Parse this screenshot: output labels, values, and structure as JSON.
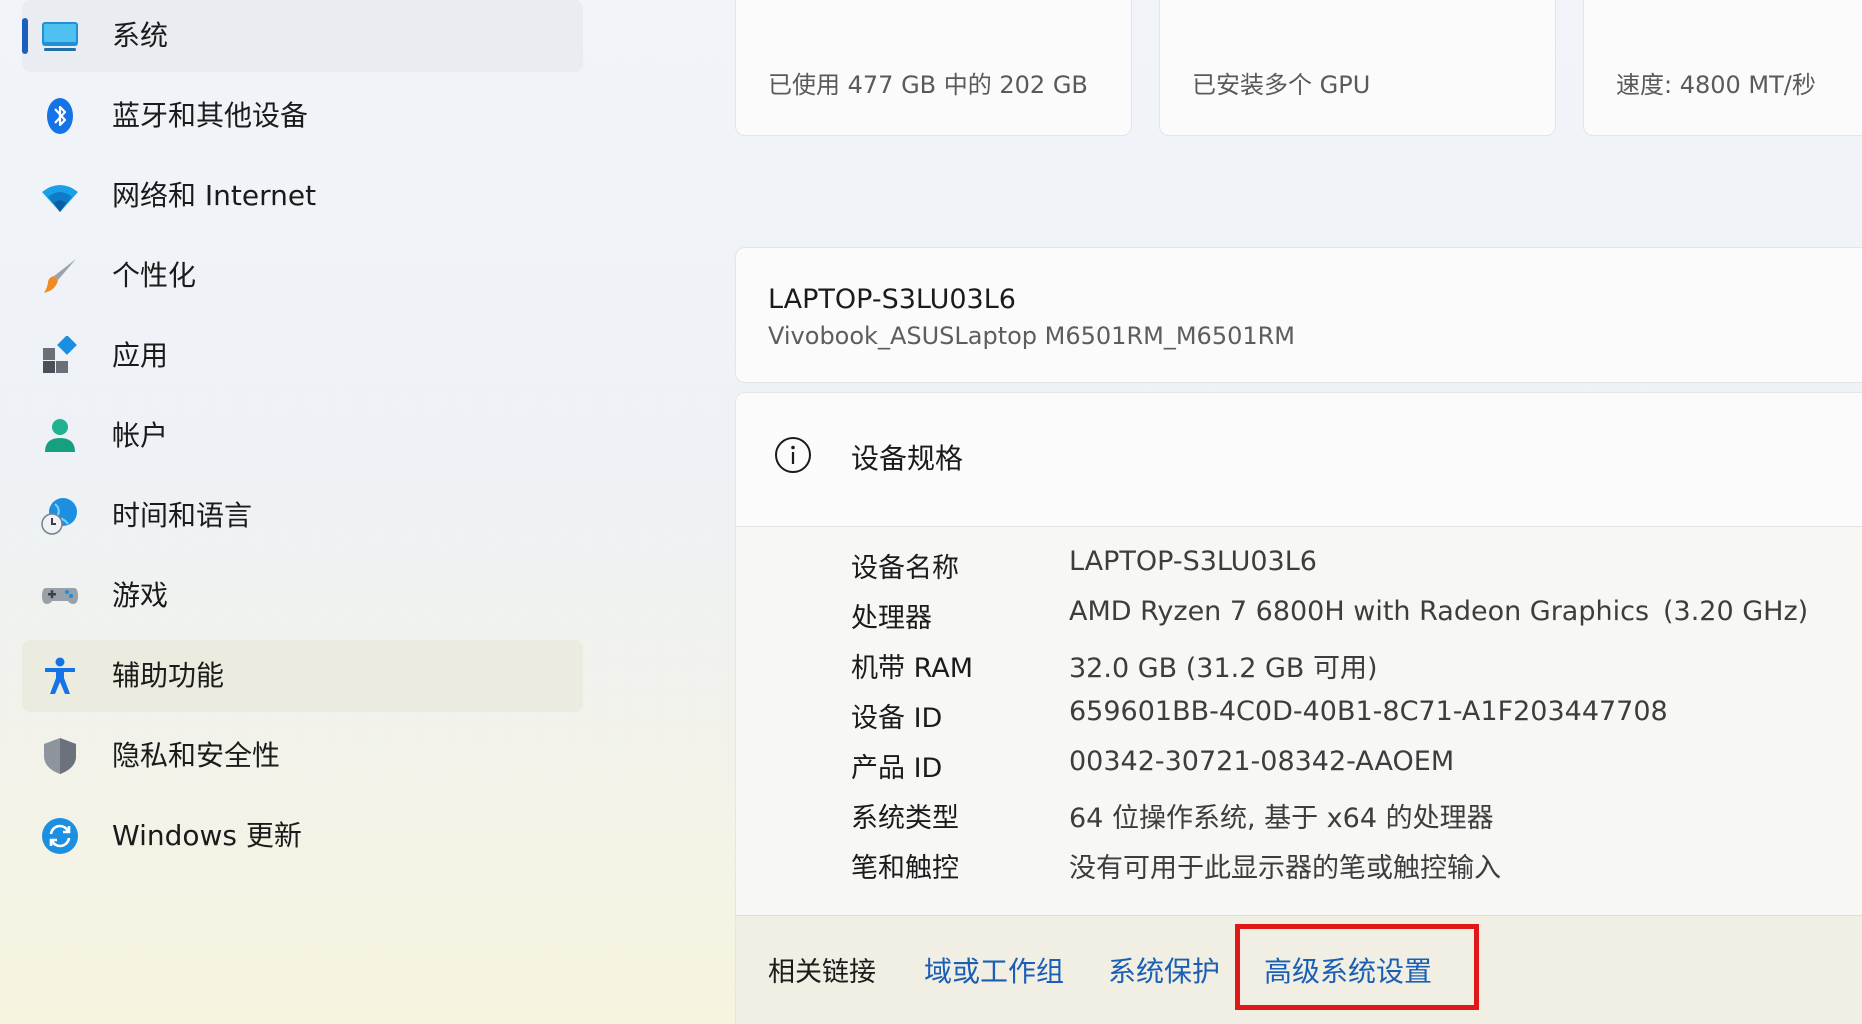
{
  "sidebar": {
    "items": [
      {
        "label": "系统",
        "icon": "monitor-icon"
      },
      {
        "label": "蓝牙和其他设备",
        "icon": "bluetooth-icon"
      },
      {
        "label": "网络和 Internet",
        "icon": "wifi-icon"
      },
      {
        "label": "个性化",
        "icon": "brush-icon"
      },
      {
        "label": "应用",
        "icon": "apps-icon"
      },
      {
        "label": "帐户",
        "icon": "person-icon"
      },
      {
        "label": "时间和语言",
        "icon": "globe-clock-icon"
      },
      {
        "label": "游戏",
        "icon": "gamepad-icon"
      },
      {
        "label": "辅助功能",
        "icon": "accessibility-icon"
      },
      {
        "label": "隐私和安全性",
        "icon": "shield-icon"
      },
      {
        "label": "Windows 更新",
        "icon": "sync-icon"
      }
    ]
  },
  "top_cards": [
    {
      "text": "已使用 477 GB 中的 202 GB"
    },
    {
      "text": "已安装多个 GPU"
    },
    {
      "text": "速度: 4800 MT/秒"
    }
  ],
  "device": {
    "name": "LAPTOP-S3LU03L6",
    "model": "Vivobook_ASUSLaptop M6501RM_M6501RM"
  },
  "specs": {
    "title": "设备规格",
    "rows": [
      {
        "key": "设备名称",
        "value": "LAPTOP-S3LU03L6",
        "extra": ""
      },
      {
        "key": "处理器",
        "value": "AMD Ryzen 7 6800H with Radeon Graphics",
        "extra": "(3.20 GHz)"
      },
      {
        "key": "机带 RAM",
        "value": "32.0 GB (31.2 GB 可用)",
        "extra": ""
      },
      {
        "key": "设备 ID",
        "value": "659601BB-4C0D-40B1-8C71-A1F203447708",
        "extra": ""
      },
      {
        "key": "产品 ID",
        "value": "00342-30721-08342-AAOEM",
        "extra": ""
      },
      {
        "key": "系统类型",
        "value": "64 位操作系统, 基于 x64 的处理器",
        "extra": ""
      },
      {
        "key": "笔和触控",
        "value": "没有可用于此显示器的笔或触控输入",
        "extra": ""
      }
    ]
  },
  "related_links": {
    "label": "相关链接",
    "links": [
      "域或工作组",
      "系统保护",
      "高级系统设置"
    ]
  },
  "colors": {
    "accent": "#1d5fbf",
    "link": "#1a5fb4",
    "highlight": "#e01818"
  }
}
